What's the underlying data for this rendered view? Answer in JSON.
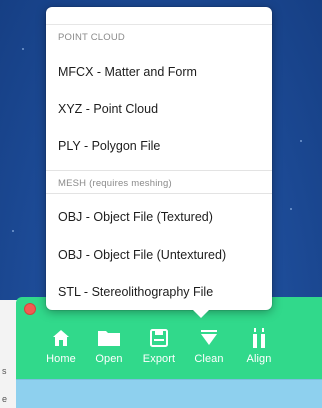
{
  "export_menu": {
    "point_cloud_header": "POINT CLOUD",
    "mesh_header": "MESH (requires meshing)",
    "point_cloud_items": [
      "MFCX - Matter and Form",
      "XYZ - Point Cloud",
      "PLY - Polygon File"
    ],
    "mesh_items": [
      "OBJ - Object File (Textured)",
      "OBJ - Object File (Untextured)",
      "STL - Stereolithography File"
    ]
  },
  "toolbar": {
    "home": "Home",
    "open": "Open",
    "export": "Export",
    "clean": "Clean",
    "align": "Align"
  },
  "left_strip_marks": [
    "s",
    "e"
  ],
  "colors": {
    "toolbar_bg": "#31d98b",
    "viewport_bg": "#1f4f9d",
    "bottom_panel": "#8ed0ee",
    "close_button": "#f25b52"
  },
  "icons": [
    "home-icon",
    "folder-icon",
    "save-icon",
    "funnel-icon",
    "align-icon"
  ]
}
